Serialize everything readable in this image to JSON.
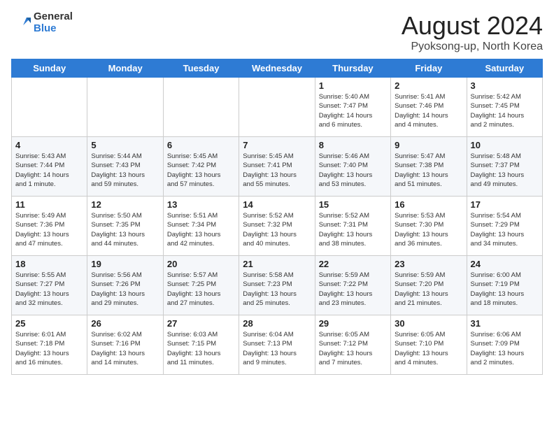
{
  "logo": {
    "general": "General",
    "blue": "Blue"
  },
  "title": "August 2024",
  "location": "Pyoksong-up, North Korea",
  "weekdays": [
    "Sunday",
    "Monday",
    "Tuesday",
    "Wednesday",
    "Thursday",
    "Friday",
    "Saturday"
  ],
  "weeks": [
    [
      {
        "day": "",
        "info": ""
      },
      {
        "day": "",
        "info": ""
      },
      {
        "day": "",
        "info": ""
      },
      {
        "day": "",
        "info": ""
      },
      {
        "day": "1",
        "info": "Sunrise: 5:40 AM\nSunset: 7:47 PM\nDaylight: 14 hours\nand 6 minutes."
      },
      {
        "day": "2",
        "info": "Sunrise: 5:41 AM\nSunset: 7:46 PM\nDaylight: 14 hours\nand 4 minutes."
      },
      {
        "day": "3",
        "info": "Sunrise: 5:42 AM\nSunset: 7:45 PM\nDaylight: 14 hours\nand 2 minutes."
      }
    ],
    [
      {
        "day": "4",
        "info": "Sunrise: 5:43 AM\nSunset: 7:44 PM\nDaylight: 14 hours\nand 1 minute."
      },
      {
        "day": "5",
        "info": "Sunrise: 5:44 AM\nSunset: 7:43 PM\nDaylight: 13 hours\nand 59 minutes."
      },
      {
        "day": "6",
        "info": "Sunrise: 5:45 AM\nSunset: 7:42 PM\nDaylight: 13 hours\nand 57 minutes."
      },
      {
        "day": "7",
        "info": "Sunrise: 5:45 AM\nSunset: 7:41 PM\nDaylight: 13 hours\nand 55 minutes."
      },
      {
        "day": "8",
        "info": "Sunrise: 5:46 AM\nSunset: 7:40 PM\nDaylight: 13 hours\nand 53 minutes."
      },
      {
        "day": "9",
        "info": "Sunrise: 5:47 AM\nSunset: 7:38 PM\nDaylight: 13 hours\nand 51 minutes."
      },
      {
        "day": "10",
        "info": "Sunrise: 5:48 AM\nSunset: 7:37 PM\nDaylight: 13 hours\nand 49 minutes."
      }
    ],
    [
      {
        "day": "11",
        "info": "Sunrise: 5:49 AM\nSunset: 7:36 PM\nDaylight: 13 hours\nand 47 minutes."
      },
      {
        "day": "12",
        "info": "Sunrise: 5:50 AM\nSunset: 7:35 PM\nDaylight: 13 hours\nand 44 minutes."
      },
      {
        "day": "13",
        "info": "Sunrise: 5:51 AM\nSunset: 7:34 PM\nDaylight: 13 hours\nand 42 minutes."
      },
      {
        "day": "14",
        "info": "Sunrise: 5:52 AM\nSunset: 7:32 PM\nDaylight: 13 hours\nand 40 minutes."
      },
      {
        "day": "15",
        "info": "Sunrise: 5:52 AM\nSunset: 7:31 PM\nDaylight: 13 hours\nand 38 minutes."
      },
      {
        "day": "16",
        "info": "Sunrise: 5:53 AM\nSunset: 7:30 PM\nDaylight: 13 hours\nand 36 minutes."
      },
      {
        "day": "17",
        "info": "Sunrise: 5:54 AM\nSunset: 7:29 PM\nDaylight: 13 hours\nand 34 minutes."
      }
    ],
    [
      {
        "day": "18",
        "info": "Sunrise: 5:55 AM\nSunset: 7:27 PM\nDaylight: 13 hours\nand 32 minutes."
      },
      {
        "day": "19",
        "info": "Sunrise: 5:56 AM\nSunset: 7:26 PM\nDaylight: 13 hours\nand 29 minutes."
      },
      {
        "day": "20",
        "info": "Sunrise: 5:57 AM\nSunset: 7:25 PM\nDaylight: 13 hours\nand 27 minutes."
      },
      {
        "day": "21",
        "info": "Sunrise: 5:58 AM\nSunset: 7:23 PM\nDaylight: 13 hours\nand 25 minutes."
      },
      {
        "day": "22",
        "info": "Sunrise: 5:59 AM\nSunset: 7:22 PM\nDaylight: 13 hours\nand 23 minutes."
      },
      {
        "day": "23",
        "info": "Sunrise: 5:59 AM\nSunset: 7:20 PM\nDaylight: 13 hours\nand 21 minutes."
      },
      {
        "day": "24",
        "info": "Sunrise: 6:00 AM\nSunset: 7:19 PM\nDaylight: 13 hours\nand 18 minutes."
      }
    ],
    [
      {
        "day": "25",
        "info": "Sunrise: 6:01 AM\nSunset: 7:18 PM\nDaylight: 13 hours\nand 16 minutes."
      },
      {
        "day": "26",
        "info": "Sunrise: 6:02 AM\nSunset: 7:16 PM\nDaylight: 13 hours\nand 14 minutes."
      },
      {
        "day": "27",
        "info": "Sunrise: 6:03 AM\nSunset: 7:15 PM\nDaylight: 13 hours\nand 11 minutes."
      },
      {
        "day": "28",
        "info": "Sunrise: 6:04 AM\nSunset: 7:13 PM\nDaylight: 13 hours\nand 9 minutes."
      },
      {
        "day": "29",
        "info": "Sunrise: 6:05 AM\nSunset: 7:12 PM\nDaylight: 13 hours\nand 7 minutes."
      },
      {
        "day": "30",
        "info": "Sunrise: 6:05 AM\nSunset: 7:10 PM\nDaylight: 13 hours\nand 4 minutes."
      },
      {
        "day": "31",
        "info": "Sunrise: 6:06 AM\nSunset: 7:09 PM\nDaylight: 13 hours\nand 2 minutes."
      }
    ]
  ]
}
